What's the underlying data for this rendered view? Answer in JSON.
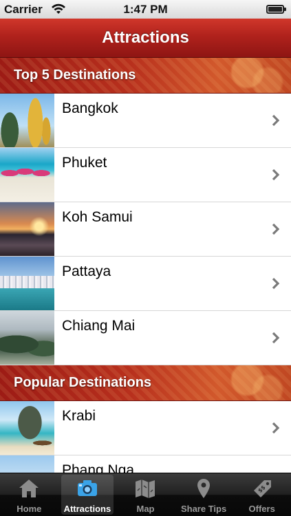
{
  "status_bar": {
    "carrier": "Carrier",
    "time": "1:47 PM"
  },
  "nav": {
    "title": "Attractions"
  },
  "sections": [
    {
      "title": "Top 5 Destinations",
      "items": [
        {
          "name": "Bangkok",
          "thumb": "bangkok"
        },
        {
          "name": "Phuket",
          "thumb": "phuket"
        },
        {
          "name": "Koh Samui",
          "thumb": "samui"
        },
        {
          "name": "Pattaya",
          "thumb": "pattaya"
        },
        {
          "name": "Chiang Mai",
          "thumb": "chiangmai"
        }
      ]
    },
    {
      "title": "Popular Destinations",
      "items": [
        {
          "name": "Krabi",
          "thumb": "krabi"
        },
        {
          "name": "Phang Nga",
          "thumb": "phangnga"
        }
      ]
    }
  ],
  "tabs": [
    {
      "label": "Home",
      "icon": "house-icon",
      "active": false
    },
    {
      "label": "Attractions",
      "icon": "camera-icon",
      "active": true
    },
    {
      "label": "Map",
      "icon": "map-icon",
      "active": false
    },
    {
      "label": "Share Tips",
      "icon": "location-pin-icon",
      "active": false
    },
    {
      "label": "Offers",
      "icon": "price-tag-icon",
      "active": false
    }
  ],
  "colors": {
    "nav_red": "#b0221c",
    "tab_active": "#ffffff",
    "tab_inactive": "#9a9a9a",
    "icon_active_blue": "#3aa3e8"
  }
}
